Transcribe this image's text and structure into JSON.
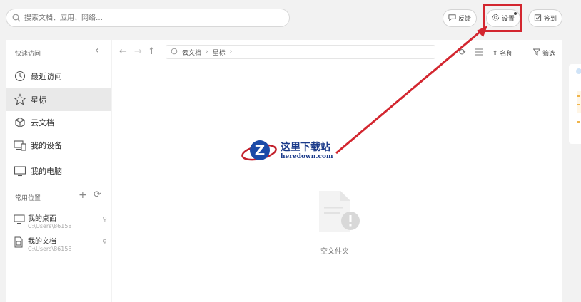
{
  "search": {
    "placeholder": "搜索文档、应用、网络…"
  },
  "top_actions": {
    "feedback_label": "反馈",
    "settings_label": "设置",
    "checkin_label": "签到"
  },
  "sidebar": {
    "quick_access_label": "快速访问",
    "items": [
      {
        "label": "最近访问",
        "icon": "clock-icon"
      },
      {
        "label": "星标",
        "icon": "star-icon"
      },
      {
        "label": "云文档",
        "icon": "cloud-box-icon"
      },
      {
        "label": "我的设备",
        "icon": "devices-icon"
      },
      {
        "label": "我的电脑",
        "icon": "monitor-icon"
      }
    ],
    "common_places_label": "常用位置",
    "places": [
      {
        "title": "我的桌面",
        "path": "C:\\Users\\86158"
      },
      {
        "title": "我的文档",
        "path": "C:\\Users\\86158"
      }
    ]
  },
  "main": {
    "breadcrumb": [
      "云文档",
      "星标"
    ],
    "sort_label": "名称",
    "filter_label": "筛选",
    "empty_label": "空文件夹"
  },
  "watermark": {
    "cn": "这里下载站",
    "en": "heredown.com"
  },
  "colors": {
    "highlight": "#d3262f",
    "arrow": "#d3262f",
    "watermark": "#1a3a8a"
  }
}
